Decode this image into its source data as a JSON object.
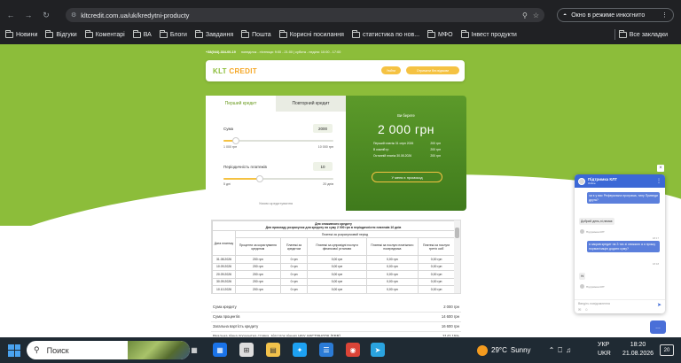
{
  "browser": {
    "url": "kltcredit.com.ua/uk/kredytni-producty",
    "incognito_label": "Окно в режиме инкогнито",
    "bookmarks": [
      "Новини",
      "Відгуки",
      "Коментарі",
      "ВА",
      "Блоги",
      "Завдання",
      "Пошта",
      "Корисні посилання",
      "статистика по нов...",
      "МФО",
      "Інвест продукти"
    ],
    "all_bookmarks": "Все закладки"
  },
  "site": {
    "phone": "+38(044)-334-00-19",
    "hours": "понеділок - п'ятниця: 9:00 - 21:00 | субота - неділя: 10:00 - 17:00",
    "logo_a": "KLT",
    "logo_b": "CREDIT",
    "btn_login": "Увійти",
    "btn_register": "Отримати без відмови"
  },
  "calculator": {
    "tab_first": "Перший кредит",
    "tab_repeat": "Повторний кредит",
    "amount_label": "Сума",
    "amount_value": "2000",
    "amount_min": "1 000 грн",
    "amount_max": "10 000 грн",
    "amount_fraction": 0.11,
    "period_label": "Періодичність платежів",
    "period_value": "10",
    "period_min": "5 дні",
    "period_max": "20 днів",
    "period_fraction": 0.33,
    "terms_link": "Умови кредитування"
  },
  "summary": {
    "label": "Ви берете",
    "amount": "2 000 грн",
    "rows": [
      {
        "k": "Перший платіж 31 серп 2026",
        "v": "200 грн"
      },
      {
        "k": "В кожній гр",
        "v": "200 грн"
      },
      {
        "k": "Останній платіж 30.08.2026",
        "v": "200 грн"
      }
    ],
    "button": "У меня є промокод"
  },
  "schedule": {
    "title": "Для споживчого кредиту",
    "subtitle": "Для прикладу розрахунок для кредиту на суму 2 000 грн в періодичністю платежів 10 днів",
    "col_date": "Дата платежу",
    "group_header": "Платежі за розрахунковий період",
    "cols": [
      "Проценти за користування кредитом",
      "Платежі за кредитом",
      "Платежі за супровідні послуги фінансової установи",
      "Платежі за послуги платіжного посередника",
      "Платежі за послуги третіх осіб"
    ],
    "rows": [
      [
        "31.08.2026",
        "200 грн",
        "0 грн",
        "0,00 грн",
        "0,00 грн",
        "0,00 грн"
      ],
      [
        "10.09.2026",
        "200 грн",
        "0 грн",
        "0,00 грн",
        "0,00 грн",
        "0,00 грн"
      ],
      [
        "20.09.2026",
        "200 грн",
        "0 грн",
        "0,00 грн",
        "0,00 грн",
        "0,00 грн"
      ],
      [
        "30.09.2026",
        "200 грн",
        "0 грн",
        "0,00 грн",
        "0,00 грн",
        "0,00 грн"
      ],
      [
        "10.10.2026",
        "200 грн",
        "0 грн",
        "0,00 грн",
        "0,00 грн",
        "0,00 грн"
      ],
      [
        "20.10.2026",
        "200 грн",
        "0 грн",
        "0,00 грн",
        "0,00 грн",
        "0,00 грн"
      ]
    ]
  },
  "totals": [
    {
      "k": "Сума кредиту",
      "v": "2 000 грн"
    },
    {
      "k": "Сума процентів",
      "v": "14 600 грн"
    },
    {
      "k": "Загальна вартість кредиту",
      "v": "16 600 грн"
    },
    {
      "k": "Реальна річна процентна ставка, відсоток річних НБУ ЧИСТЯНДОК (ЕРR)",
      "v": "3142.15%"
    }
  ],
  "chat": {
    "header": "Підтримка КЛТ",
    "status": "Online",
    "msg1": "чи є у вас Реферальна програма, типу Приведи друга?",
    "op_name": "Підтримка КЛТ",
    "op1": "Добрий день,ні,немає",
    "time1": "18:17",
    "msg2": "я закрив кредит на 3 тис зі знижкою а я прошу нормалізацію додати суму?",
    "time2": "18:18",
    "op2": "Ні",
    "input_placeholder": "Введіть повідомлення"
  },
  "taskbar": {
    "search": "Поиск",
    "weather": "29°C",
    "weather_text": "Sunny",
    "lang1": "УКР",
    "lang2": "UKR",
    "time": "18:20",
    "date": "21.08.2026",
    "notifications": "20"
  },
  "colors": {
    "brand_green": "#8cbd3a",
    "accent_yellow": "#f5c242",
    "chat_blue": "#3b68d6"
  }
}
